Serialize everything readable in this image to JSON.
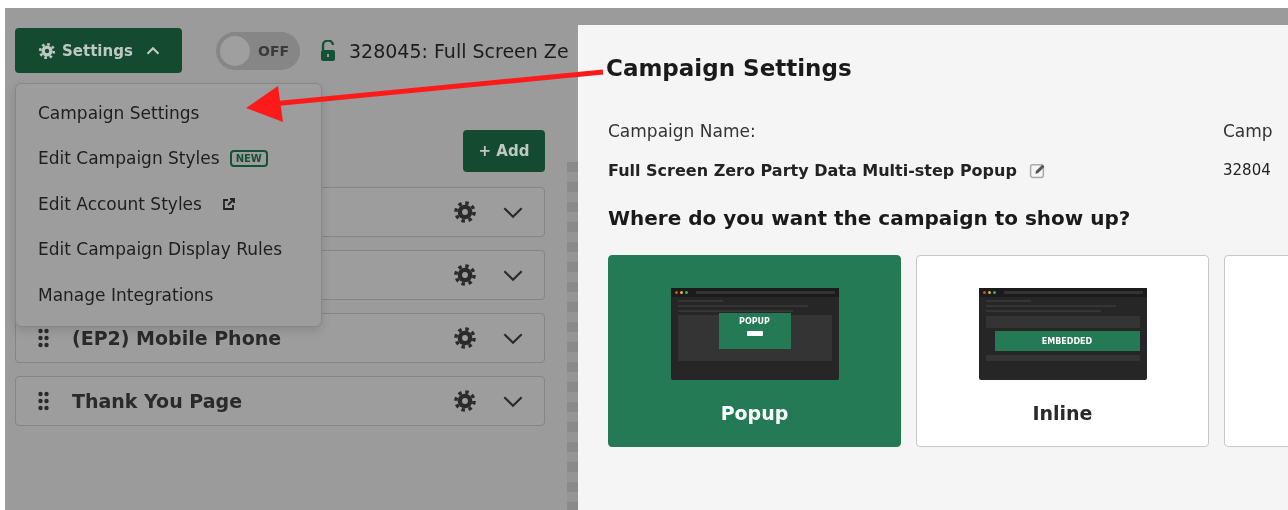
{
  "toolbar": {
    "settings_button": {
      "label": "Settings",
      "expanded": true
    },
    "toggle": {
      "label": "OFF",
      "on": false
    },
    "campaign_title": "328045: Full Screen Ze"
  },
  "settings_menu": {
    "items": [
      {
        "label": "Campaign Settings",
        "kind": "plain"
      },
      {
        "label": "Edit Campaign Styles",
        "kind": "badge",
        "badge": "NEW"
      },
      {
        "label": "Edit Account Styles",
        "kind": "external"
      },
      {
        "label": "Edit Campaign Display Rules",
        "kind": "plain"
      },
      {
        "label": "Manage Integrations",
        "kind": "plain"
      }
    ]
  },
  "add_button": "+ Add",
  "steps": [
    {
      "kind": "hidden"
    },
    {
      "kind": "hidden"
    },
    {
      "kind": "step",
      "title": "(EP2) Mobile Phone"
    },
    {
      "kind": "step",
      "title": "Thank You Page"
    }
  ],
  "panel": {
    "title": "Campaign Settings",
    "fields": [
      {
        "label": "Campaign Name:",
        "value": "Full Screen Zero Party Data Multi-step Popup",
        "editable": true
      },
      {
        "label": "Camp",
        "value": "32804",
        "editable": false
      }
    ],
    "question": "Where do you want the campaign to show up?",
    "placements": [
      {
        "kind": "popup",
        "label": "Popup",
        "preview": "POPUP",
        "selected": true
      },
      {
        "kind": "embedded",
        "label": "Inline",
        "preview": "EMBEDDED",
        "selected": false
      },
      {
        "kind": "other",
        "selected": false
      }
    ]
  }
}
